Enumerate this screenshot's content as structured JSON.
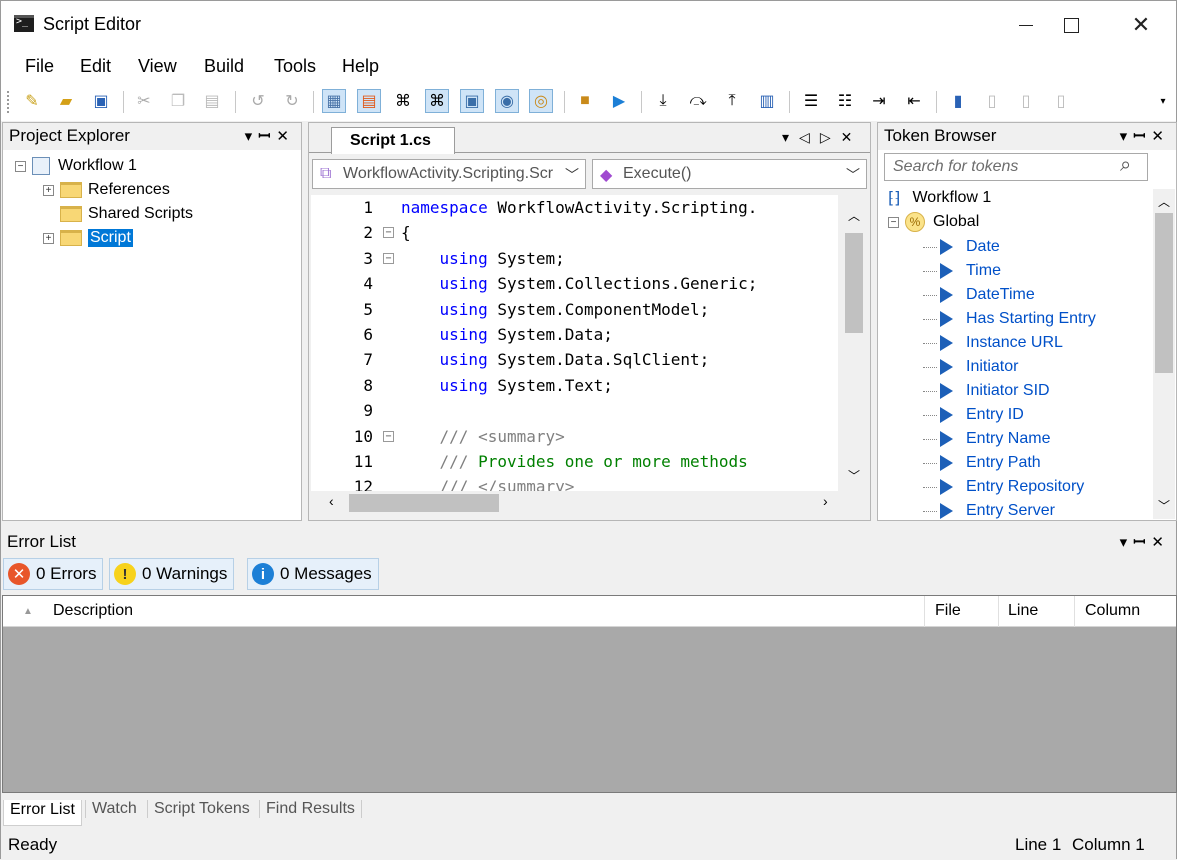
{
  "window": {
    "title": "Script Editor"
  },
  "menu": [
    "File",
    "Edit",
    "View",
    "Build",
    "Tools",
    "Help"
  ],
  "project_explorer": {
    "title": "Project Explorer",
    "root": "Workflow 1",
    "items": [
      "References",
      "Shared Scripts",
      "Script"
    ],
    "selected": "Script"
  },
  "editor": {
    "tab": "Script 1.cs",
    "namespace_combo": "WorkflowActivity.Scripting.Scr",
    "member_combo": "Execute()",
    "lines": [
      {
        "n": "1",
        "parts": [
          [
            "kw",
            "namespace"
          ],
          [
            "",
            " WorkflowActivity.Scripting."
          ]
        ]
      },
      {
        "n": "2",
        "parts": [
          [
            "",
            "{"
          ]
        ]
      },
      {
        "n": "3",
        "parts": [
          [
            "",
            "    "
          ],
          [
            "kw",
            "using"
          ],
          [
            "",
            " System;"
          ]
        ]
      },
      {
        "n": "4",
        "parts": [
          [
            "",
            "    "
          ],
          [
            "kw",
            "using"
          ],
          [
            "",
            " System.Collections.Generic;"
          ]
        ]
      },
      {
        "n": "5",
        "parts": [
          [
            "",
            "    "
          ],
          [
            "kw",
            "using"
          ],
          [
            "",
            " System.ComponentModel;"
          ]
        ]
      },
      {
        "n": "6",
        "parts": [
          [
            "",
            "    "
          ],
          [
            "kw",
            "using"
          ],
          [
            "",
            " System.Data;"
          ]
        ]
      },
      {
        "n": "7",
        "parts": [
          [
            "",
            "    "
          ],
          [
            "kw",
            "using"
          ],
          [
            "",
            " System.Data.SqlClient;"
          ]
        ]
      },
      {
        "n": "8",
        "parts": [
          [
            "",
            "    "
          ],
          [
            "kw",
            "using"
          ],
          [
            "",
            " System.Text;"
          ]
        ]
      },
      {
        "n": "9",
        "parts": []
      },
      {
        "n": "10",
        "parts": [
          [
            "",
            "    "
          ],
          [
            "xg",
            "///"
          ],
          [
            "xg",
            " <summary>"
          ]
        ]
      },
      {
        "n": "11",
        "parts": [
          [
            "",
            "    "
          ],
          [
            "xg",
            "///"
          ],
          [
            "cm",
            " Provides one or more methods"
          ]
        ]
      },
      {
        "n": "12",
        "parts": [
          [
            "",
            "    "
          ],
          [
            "xg",
            "/// </summary>"
          ]
        ]
      }
    ]
  },
  "token_browser": {
    "title": "Token Browser",
    "search_placeholder": "Search for tokens",
    "root": "Workflow 1",
    "group": "Global",
    "tokens": [
      "Date",
      "Time",
      "DateTime",
      "Has Starting Entry",
      "Instance URL",
      "Initiator",
      "Initiator SID",
      "Entry ID",
      "Entry Name",
      "Entry Path",
      "Entry Repository",
      "Entry Server"
    ]
  },
  "error_list": {
    "title": "Error List",
    "errors": "0 Errors",
    "warnings": "0 Warnings",
    "messages": "0 Messages",
    "columns": [
      "Description",
      "File",
      "Line",
      "Column"
    ]
  },
  "bottom_tabs": [
    "Error List",
    "Watch",
    "Script Tokens",
    "Find Results"
  ],
  "status": {
    "left": "Ready",
    "line": "Line 1",
    "column": "Column 1"
  }
}
